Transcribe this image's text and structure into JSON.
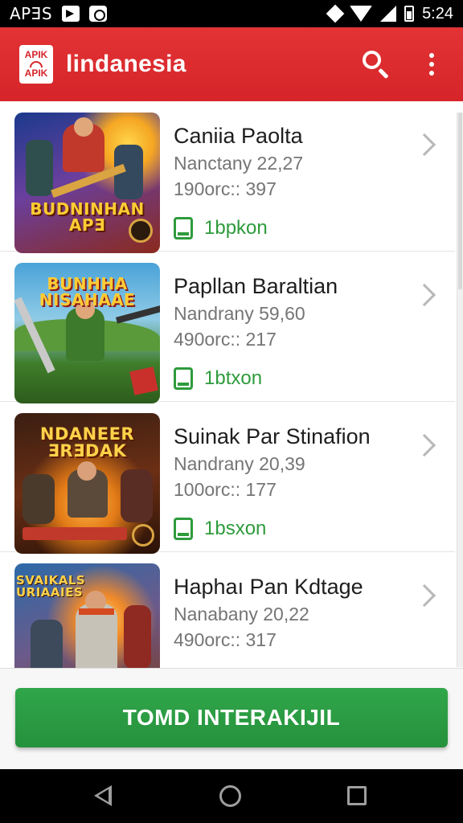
{
  "status_bar": {
    "carrier": "APƎS",
    "time": "5:24",
    "icons": [
      "play-notification-icon",
      "shield-notification-icon",
      "data-diamond-icon",
      "wifi-icon",
      "signal-icon",
      "battery-icon"
    ]
  },
  "app_bar": {
    "logo_top": "APIK",
    "logo_bottom": "APIK",
    "title": "lindanesia",
    "icons": [
      "search-icon",
      "overflow-menu-icon"
    ]
  },
  "list": {
    "items": [
      {
        "title": "Caniia Paolta",
        "line1": "Nanctany 22,27",
        "line2": "190orc:: 397",
        "status": "1bpkon",
        "thumb_text": "BUDNINHAN APƎ",
        "colors": [
          "#1b3a8c",
          "#f5a623",
          "#8b2a1c"
        ]
      },
      {
        "title": "Papllan Baraltian",
        "line1": "Nandrany 59,60",
        "line2": "490orc:: 217",
        "status": "1btxon",
        "thumb_text": "BUNHHA NISAHAAE",
        "colors": [
          "#4aa3d8",
          "#3f7d2a",
          "#c9302c"
        ]
      },
      {
        "title": "Suinak Par Stinafion",
        "line1": "Nandrany 20,39",
        "line2": "100orc:: 177",
        "status": "1bsxon",
        "thumb_text": "NDANEER ƎRƎDAK",
        "colors": [
          "#3a1e12",
          "#e37b17",
          "#c0392b"
        ]
      },
      {
        "title": "Haphaı Pan Kdtage",
        "line1": "Nanabany 20,22",
        "line2": "490orc:: 317",
        "status": "",
        "thumb_text": "SVAIKALS URIAAIES",
        "colors": [
          "#2c6aa8",
          "#d64a1f",
          "#c7c2b8"
        ]
      }
    ]
  },
  "action": {
    "label": "TOMD INTERAKIJIL"
  },
  "nav_bar": {
    "icons": [
      "back-icon",
      "home-icon",
      "recents-icon"
    ]
  }
}
